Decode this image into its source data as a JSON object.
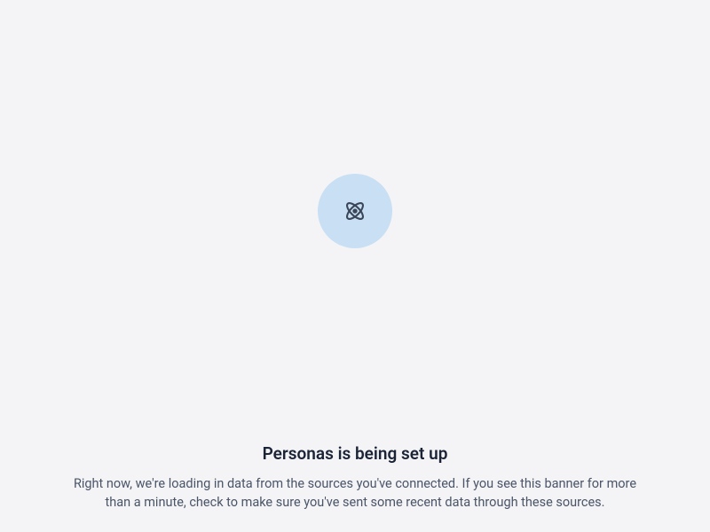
{
  "icon": {
    "name": "atom-icon",
    "stroke_color": "#3b4758",
    "bg_color": "#c9dff3"
  },
  "heading": "Personas is being set up",
  "body": "Right now, we're loading in data from the sources you've connected. If you see this banner for more than a minute, check to make sure you've sent some recent data through these sources."
}
